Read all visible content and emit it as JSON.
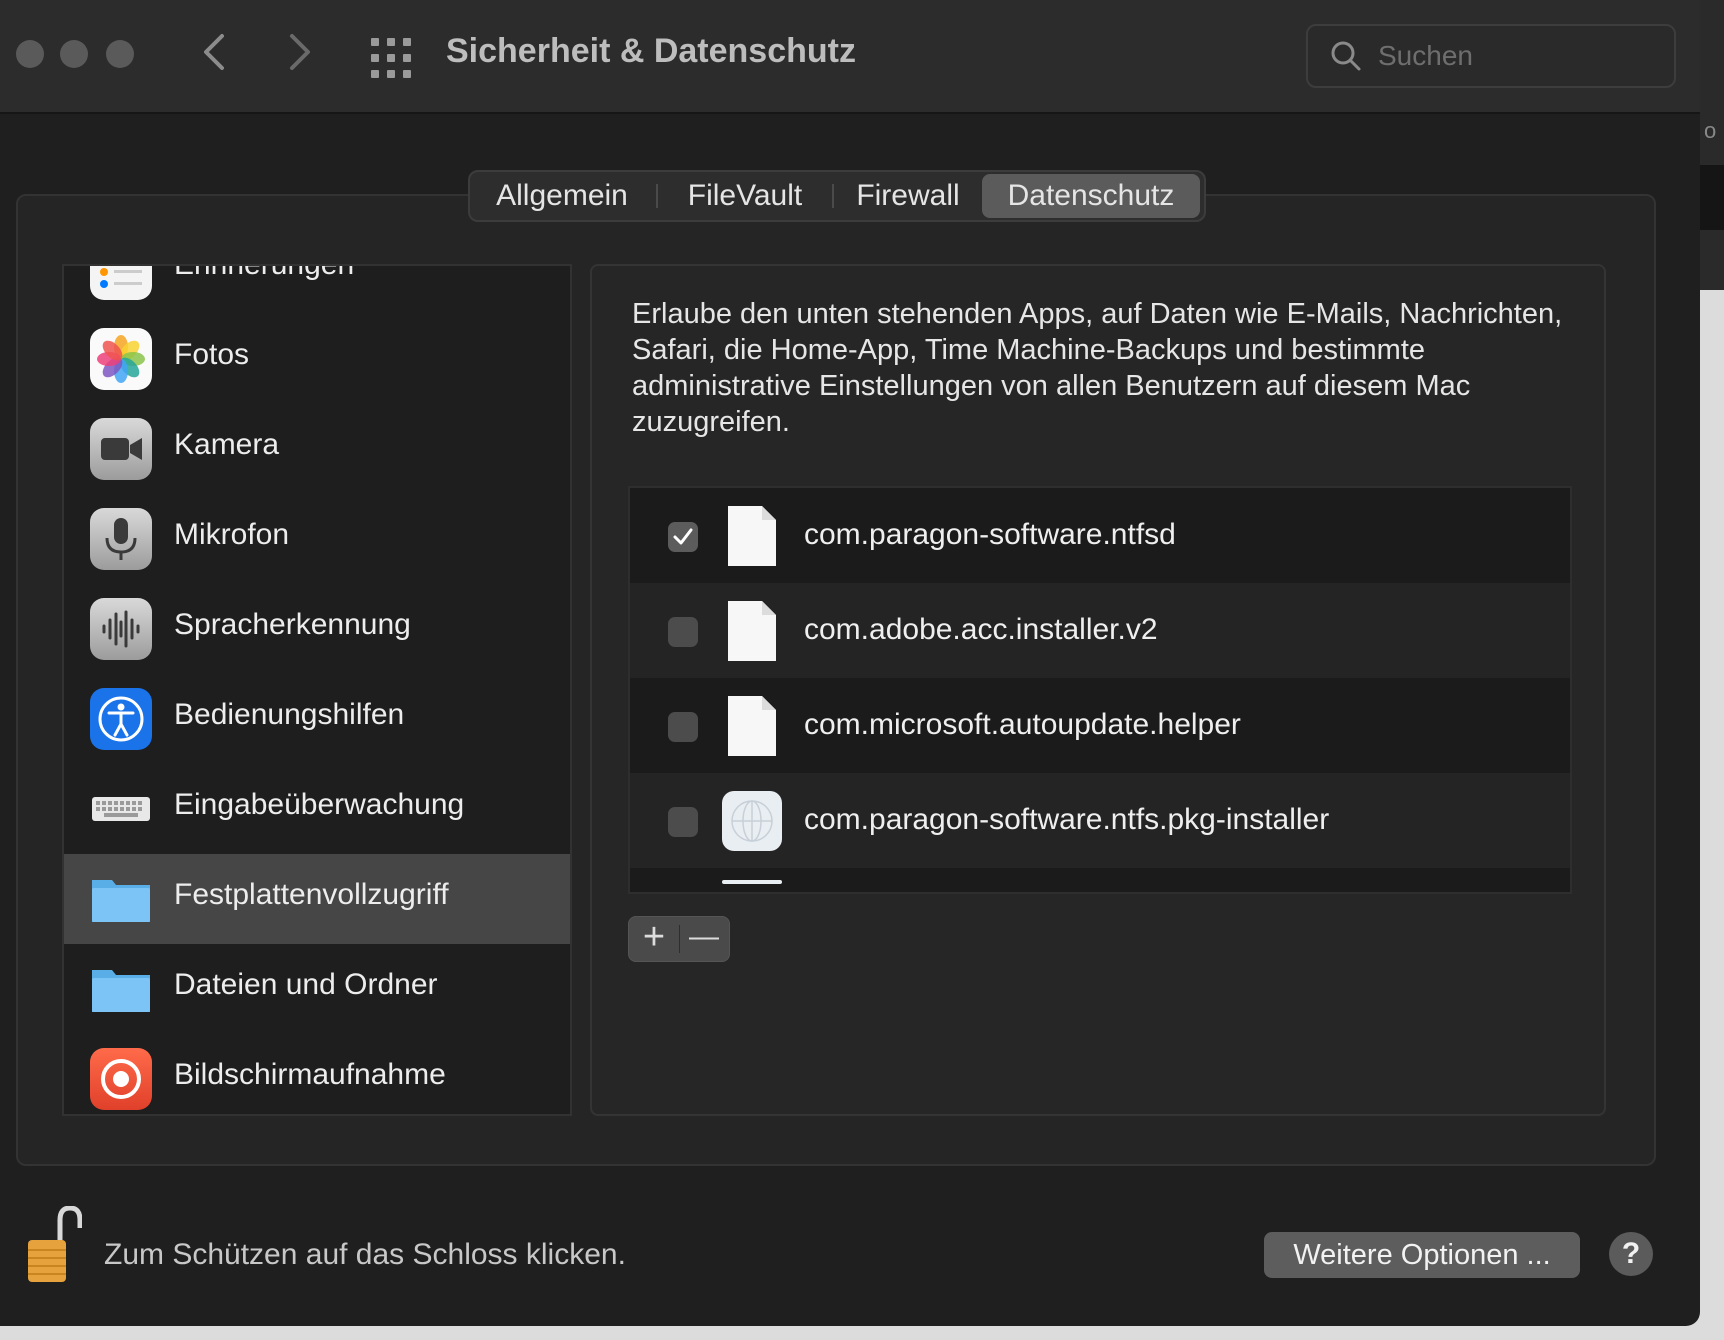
{
  "window": {
    "title": "Sicherheit & Datenschutz"
  },
  "search": {
    "placeholder": "Suchen"
  },
  "tabs": [
    {
      "label": "Allgemein",
      "active": false
    },
    {
      "label": "FileVault",
      "active": false
    },
    {
      "label": "Firewall",
      "active": false
    },
    {
      "label": "Datenschutz",
      "active": true
    }
  ],
  "sidebar": {
    "items": [
      {
        "label": "Erinnerungen",
        "icon": "reminders-icon",
        "selected": false
      },
      {
        "label": "Fotos",
        "icon": "photos-icon",
        "selected": false
      },
      {
        "label": "Kamera",
        "icon": "camera-icon",
        "selected": false
      },
      {
        "label": "Mikrofon",
        "icon": "microphone-icon",
        "selected": false
      },
      {
        "label": "Spracherkennung",
        "icon": "speech-recognition-icon",
        "selected": false
      },
      {
        "label": "Bedienungshilfen",
        "icon": "accessibility-icon",
        "selected": false
      },
      {
        "label": "Eingabeüberwachung",
        "icon": "keyboard-icon",
        "selected": false
      },
      {
        "label": "Festplattenvollzugriff",
        "icon": "folder-icon",
        "selected": true
      },
      {
        "label": "Dateien und Ordner",
        "icon": "folder-icon",
        "selected": false
      },
      {
        "label": "Bildschirmaufnahme",
        "icon": "screen-recording-icon",
        "selected": false
      }
    ]
  },
  "main": {
    "description": "Erlaube den unten stehenden Apps, auf Daten wie E-Mails, Nachrichten, Safari, die Home-App, Time Machine-Backups und bestimmte administrative Einstellungen von allen Benutzern auf diesem Mac zuzugreifen.",
    "apps": [
      {
        "name": "com.paragon-software.ntfsd",
        "checked": true,
        "icon": "document-icon"
      },
      {
        "name": "com.adobe.acc.installer.v2",
        "checked": false,
        "icon": "document-icon"
      },
      {
        "name": "com.microsoft.autoupdate.helper",
        "checked": false,
        "icon": "document-icon"
      },
      {
        "name": "com.paragon-software.ntfs.pkg-installer",
        "checked": false,
        "icon": "package-icon"
      }
    ],
    "add_label": "+",
    "remove_label": "—"
  },
  "footer": {
    "lock_text": "Zum Schützen auf das Schloss klicken.",
    "more_options": "Weitere Optionen ...",
    "help": "?"
  }
}
